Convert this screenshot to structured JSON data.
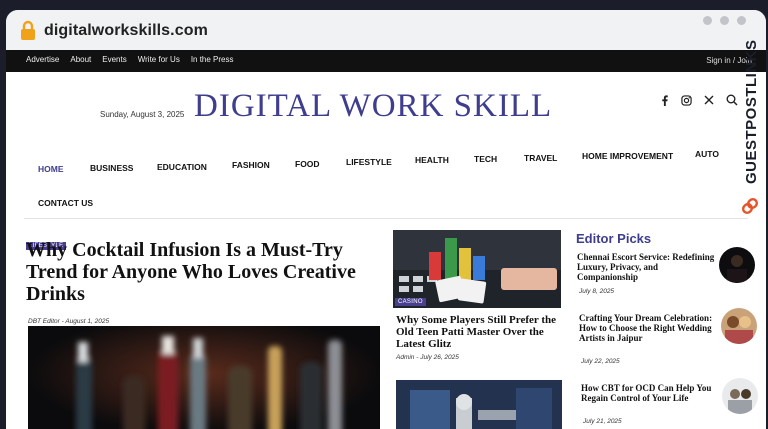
{
  "browser": {
    "url": "digitalworkskills.com"
  },
  "topbar": {
    "links": [
      "Advertise",
      "About",
      "Events",
      "Write for Us",
      "In the Press"
    ],
    "signin": "Sign in / Join"
  },
  "header": {
    "date": "Sunday, August 3, 2025",
    "logo": "DIGITAL WORK SKILL",
    "social": [
      "facebook-icon",
      "instagram-icon",
      "x-icon",
      "search-icon"
    ]
  },
  "watermark": {
    "text": "GUESTPOSTLINKS"
  },
  "nav": {
    "items": [
      "HOME",
      "BUSINESS",
      "EDUCATION",
      "FASHION",
      "FOOD",
      "LIFESTYLE",
      "HEALTH",
      "TECH",
      "TRAVEL",
      "HOME IMPROVEMENT",
      "AUTO",
      "CONTACT US"
    ],
    "active": "HOME"
  },
  "main_article": {
    "category": "LIFESTYLE",
    "title": "Why Cocktail Infusion Is a Must-Try Trend for Anyone Who Loves Creative Drinks",
    "author": "DBT Editor",
    "date": "August 1, 2025"
  },
  "middle_articles": [
    {
      "category": "CASINO",
      "title": "Why Some Players Still Prefer the Old Teen Patti Master Over the Latest Glitz",
      "author": "Admin",
      "date": "July 26, 2025"
    }
  ],
  "editor_picks": {
    "title": "Editor Picks",
    "items": [
      {
        "title": "Chennai Escort Service: Redefining Luxury, Privacy, and Companionship",
        "date": "July 8, 2025"
      },
      {
        "title": "Crafting Your Dream Celebration: How to Choose the Right Wedding Artists in Jaipur",
        "date": "July 22, 2025"
      },
      {
        "title": "How CBT for OCD Can Help You Regain Control of Your Life",
        "date": "July 21, 2025"
      }
    ]
  },
  "colors": {
    "brand": "#3e3d8e",
    "badge": "#4a3f8f",
    "topbar": "#111111",
    "watermark": "#e5542a"
  }
}
